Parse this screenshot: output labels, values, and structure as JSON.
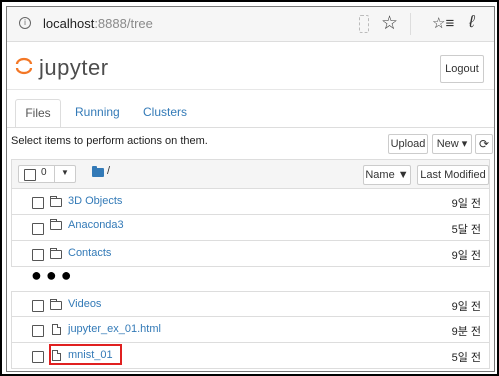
{
  "browser": {
    "url_host": "localhost",
    "url_rest": ":8888/tree"
  },
  "header": {
    "logo_text": "jupyter",
    "logout_label": "Logout"
  },
  "tabs": [
    {
      "label": "Files"
    },
    {
      "label": "Running"
    },
    {
      "label": "Clusters"
    }
  ],
  "toolbar": {
    "action_message": "Select items to perform actions on them.",
    "upload_label": "Upload",
    "new_label": "New ▾",
    "refresh_icon": "⟳"
  },
  "list_header": {
    "selected_count": "0",
    "breadcrumb_root": "/",
    "name_sort_label": "Name ▼",
    "last_modified_label": "Last Modified"
  },
  "rows": [
    {
      "name": "3D Objects",
      "time": "9일 전",
      "type": "folder"
    },
    {
      "name": "Anaconda3",
      "time": "5달 전",
      "type": "folder"
    },
    {
      "name": "Contacts",
      "time": "9일 전",
      "type": "folder"
    },
    {
      "name": "Videos",
      "time": "9일 전",
      "type": "folder"
    },
    {
      "name": "jupyter_ex_01.html",
      "time": "9분 전",
      "type": "file"
    },
    {
      "name": "mnist_01",
      "time": "5일 전",
      "type": "notebook"
    }
  ],
  "ellipsis": "●●●",
  "colors": {
    "link": "#337ab7",
    "highlight": "#e02020",
    "logo_orange": "#f37726"
  }
}
